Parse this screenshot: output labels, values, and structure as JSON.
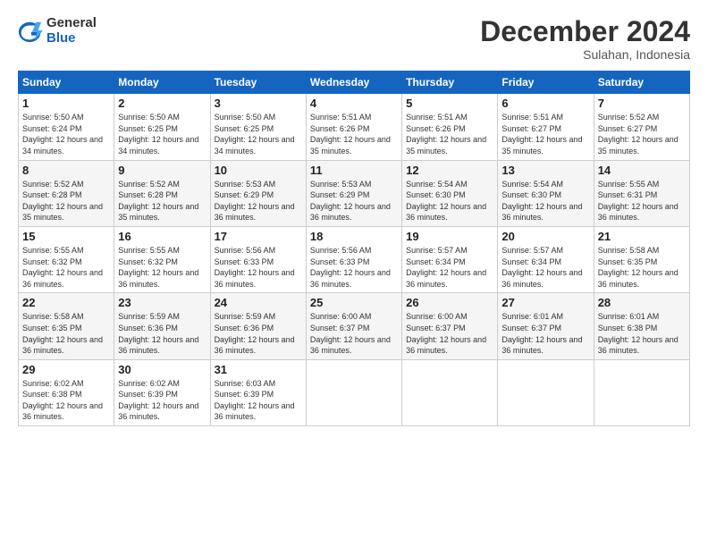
{
  "logo": {
    "general": "General",
    "blue": "Blue"
  },
  "title": "December 2024",
  "subtitle": "Sulahan, Indonesia",
  "weekdays": [
    "Sunday",
    "Monday",
    "Tuesday",
    "Wednesday",
    "Thursday",
    "Friday",
    "Saturday"
  ],
  "weeks": [
    [
      {
        "day": "1",
        "sunrise": "5:50 AM",
        "sunset": "6:24 PM",
        "daylight": "12 hours and 34 minutes."
      },
      {
        "day": "2",
        "sunrise": "5:50 AM",
        "sunset": "6:25 PM",
        "daylight": "12 hours and 34 minutes."
      },
      {
        "day": "3",
        "sunrise": "5:50 AM",
        "sunset": "6:25 PM",
        "daylight": "12 hours and 34 minutes."
      },
      {
        "day": "4",
        "sunrise": "5:51 AM",
        "sunset": "6:26 PM",
        "daylight": "12 hours and 35 minutes."
      },
      {
        "day": "5",
        "sunrise": "5:51 AM",
        "sunset": "6:26 PM",
        "daylight": "12 hours and 35 minutes."
      },
      {
        "day": "6",
        "sunrise": "5:51 AM",
        "sunset": "6:27 PM",
        "daylight": "12 hours and 35 minutes."
      },
      {
        "day": "7",
        "sunrise": "5:52 AM",
        "sunset": "6:27 PM",
        "daylight": "12 hours and 35 minutes."
      }
    ],
    [
      {
        "day": "8",
        "sunrise": "5:52 AM",
        "sunset": "6:28 PM",
        "daylight": "12 hours and 35 minutes."
      },
      {
        "day": "9",
        "sunrise": "5:52 AM",
        "sunset": "6:28 PM",
        "daylight": "12 hours and 35 minutes."
      },
      {
        "day": "10",
        "sunrise": "5:53 AM",
        "sunset": "6:29 PM",
        "daylight": "12 hours and 36 minutes."
      },
      {
        "day": "11",
        "sunrise": "5:53 AM",
        "sunset": "6:29 PM",
        "daylight": "12 hours and 36 minutes."
      },
      {
        "day": "12",
        "sunrise": "5:54 AM",
        "sunset": "6:30 PM",
        "daylight": "12 hours and 36 minutes."
      },
      {
        "day": "13",
        "sunrise": "5:54 AM",
        "sunset": "6:30 PM",
        "daylight": "12 hours and 36 minutes."
      },
      {
        "day": "14",
        "sunrise": "5:55 AM",
        "sunset": "6:31 PM",
        "daylight": "12 hours and 36 minutes."
      }
    ],
    [
      {
        "day": "15",
        "sunrise": "5:55 AM",
        "sunset": "6:32 PM",
        "daylight": "12 hours and 36 minutes."
      },
      {
        "day": "16",
        "sunrise": "5:55 AM",
        "sunset": "6:32 PM",
        "daylight": "12 hours and 36 minutes."
      },
      {
        "day": "17",
        "sunrise": "5:56 AM",
        "sunset": "6:33 PM",
        "daylight": "12 hours and 36 minutes."
      },
      {
        "day": "18",
        "sunrise": "5:56 AM",
        "sunset": "6:33 PM",
        "daylight": "12 hours and 36 minutes."
      },
      {
        "day": "19",
        "sunrise": "5:57 AM",
        "sunset": "6:34 PM",
        "daylight": "12 hours and 36 minutes."
      },
      {
        "day": "20",
        "sunrise": "5:57 AM",
        "sunset": "6:34 PM",
        "daylight": "12 hours and 36 minutes."
      },
      {
        "day": "21",
        "sunrise": "5:58 AM",
        "sunset": "6:35 PM",
        "daylight": "12 hours and 36 minutes."
      }
    ],
    [
      {
        "day": "22",
        "sunrise": "5:58 AM",
        "sunset": "6:35 PM",
        "daylight": "12 hours and 36 minutes."
      },
      {
        "day": "23",
        "sunrise": "5:59 AM",
        "sunset": "6:36 PM",
        "daylight": "12 hours and 36 minutes."
      },
      {
        "day": "24",
        "sunrise": "5:59 AM",
        "sunset": "6:36 PM",
        "daylight": "12 hours and 36 minutes."
      },
      {
        "day": "25",
        "sunrise": "6:00 AM",
        "sunset": "6:37 PM",
        "daylight": "12 hours and 36 minutes."
      },
      {
        "day": "26",
        "sunrise": "6:00 AM",
        "sunset": "6:37 PM",
        "daylight": "12 hours and 36 minutes."
      },
      {
        "day": "27",
        "sunrise": "6:01 AM",
        "sunset": "6:37 PM",
        "daylight": "12 hours and 36 minutes."
      },
      {
        "day": "28",
        "sunrise": "6:01 AM",
        "sunset": "6:38 PM",
        "daylight": "12 hours and 36 minutes."
      }
    ],
    [
      {
        "day": "29",
        "sunrise": "6:02 AM",
        "sunset": "6:38 PM",
        "daylight": "12 hours and 36 minutes."
      },
      {
        "day": "30",
        "sunrise": "6:02 AM",
        "sunset": "6:39 PM",
        "daylight": "12 hours and 36 minutes."
      },
      {
        "day": "31",
        "sunrise": "6:03 AM",
        "sunset": "6:39 PM",
        "daylight": "12 hours and 36 minutes."
      },
      null,
      null,
      null,
      null
    ]
  ]
}
